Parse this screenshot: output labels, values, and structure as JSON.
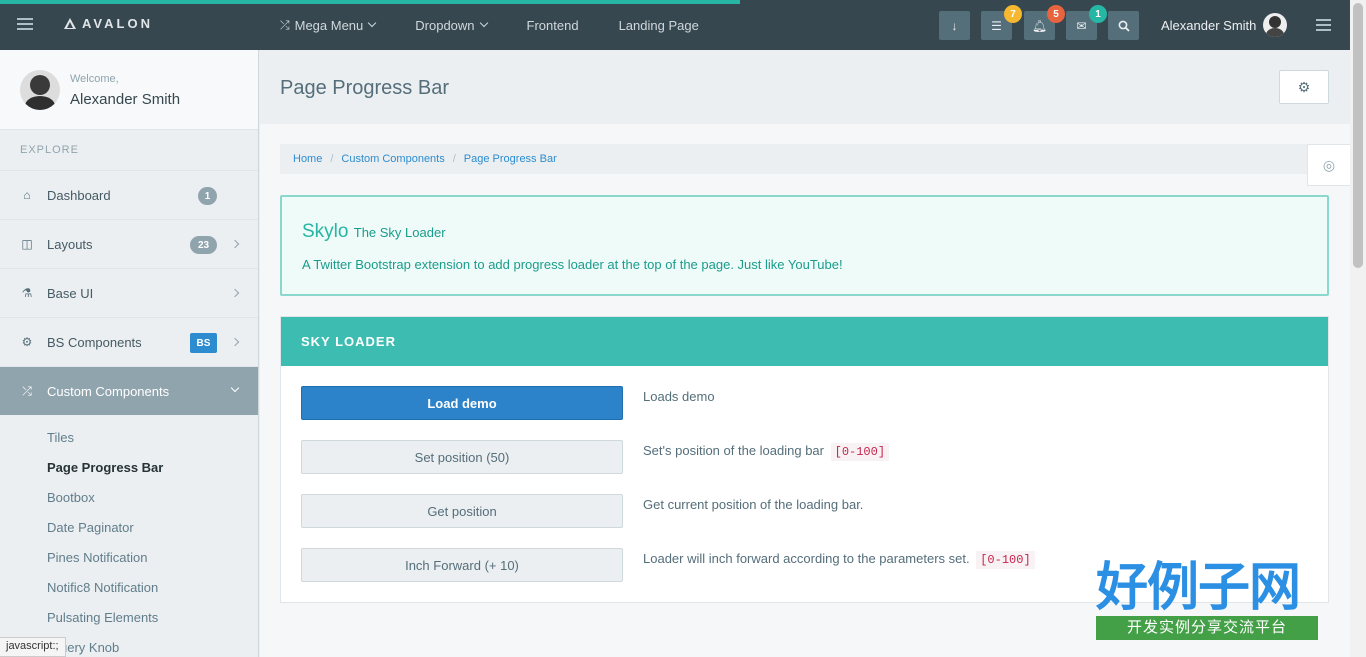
{
  "topbar": {
    "brand": "AVALON",
    "nav": [
      {
        "label": "Mega Menu",
        "icon": "shuffle-icon",
        "dropdown": true
      },
      {
        "label": "Dropdown",
        "dropdown": true
      },
      {
        "label": "Frontend"
      },
      {
        "label": "Landing Page"
      }
    ],
    "badges": {
      "tasks": "7",
      "notifications": "5",
      "messages": "1"
    },
    "badge_colors": {
      "tasks": "#f5b82e",
      "notifications": "#e8643f",
      "messages": "#26b6a3"
    },
    "user_name": "Alexander Smith"
  },
  "sidebar": {
    "welcome": "Welcome,",
    "user_name": "Alexander Smith",
    "section": "EXPLORE",
    "items": [
      {
        "label": "Dashboard",
        "icon": "home-icon",
        "count": "1"
      },
      {
        "label": "Layouts",
        "icon": "columns-icon",
        "count": "23"
      },
      {
        "label": "Base UI",
        "icon": "flask-icon"
      },
      {
        "label": "BS Components",
        "icon": "cogs-icon",
        "tag": "BS"
      },
      {
        "label": "Custom Components",
        "icon": "shuffle-icon"
      }
    ],
    "sub_items": [
      "Tiles",
      "Page Progress Bar",
      "Bootbox",
      "Date Paginator",
      "Pines Notification",
      "Notific8 Notification",
      "Pulsating Elements",
      "jQuery Knob"
    ]
  },
  "page": {
    "title": "Page Progress Bar",
    "breadcrumb": [
      "Home",
      "Custom Components",
      "Page Progress Bar"
    ]
  },
  "alert": {
    "title": "Skylo",
    "subtitle": "The Sky Loader",
    "text": "A Twitter Bootstrap extension to add progress loader at the top of the page. Just like YouTube!"
  },
  "panel": {
    "title": "SKY LOADER",
    "rows": [
      {
        "button": "Load demo",
        "desc": "Loads demo",
        "code": ""
      },
      {
        "button": "Set position (50)",
        "desc": "Set's position of the loading bar",
        "code": "[0-100]"
      },
      {
        "button": "Get position",
        "desc": "Get current position of the loading bar.",
        "code": ""
      },
      {
        "button": "Inch Forward (+ 10)",
        "desc": "Loader will inch forward according to the parameters set.",
        "code": "[0-100]"
      }
    ]
  },
  "watermark": {
    "big": "好例子网",
    "small": "开发实例分享交流平台"
  },
  "status_bar": "javascript:;",
  "colors": {
    "accent": "#26b6a3",
    "topbar": "#37474f",
    "primary_button": "#2d83c9"
  }
}
